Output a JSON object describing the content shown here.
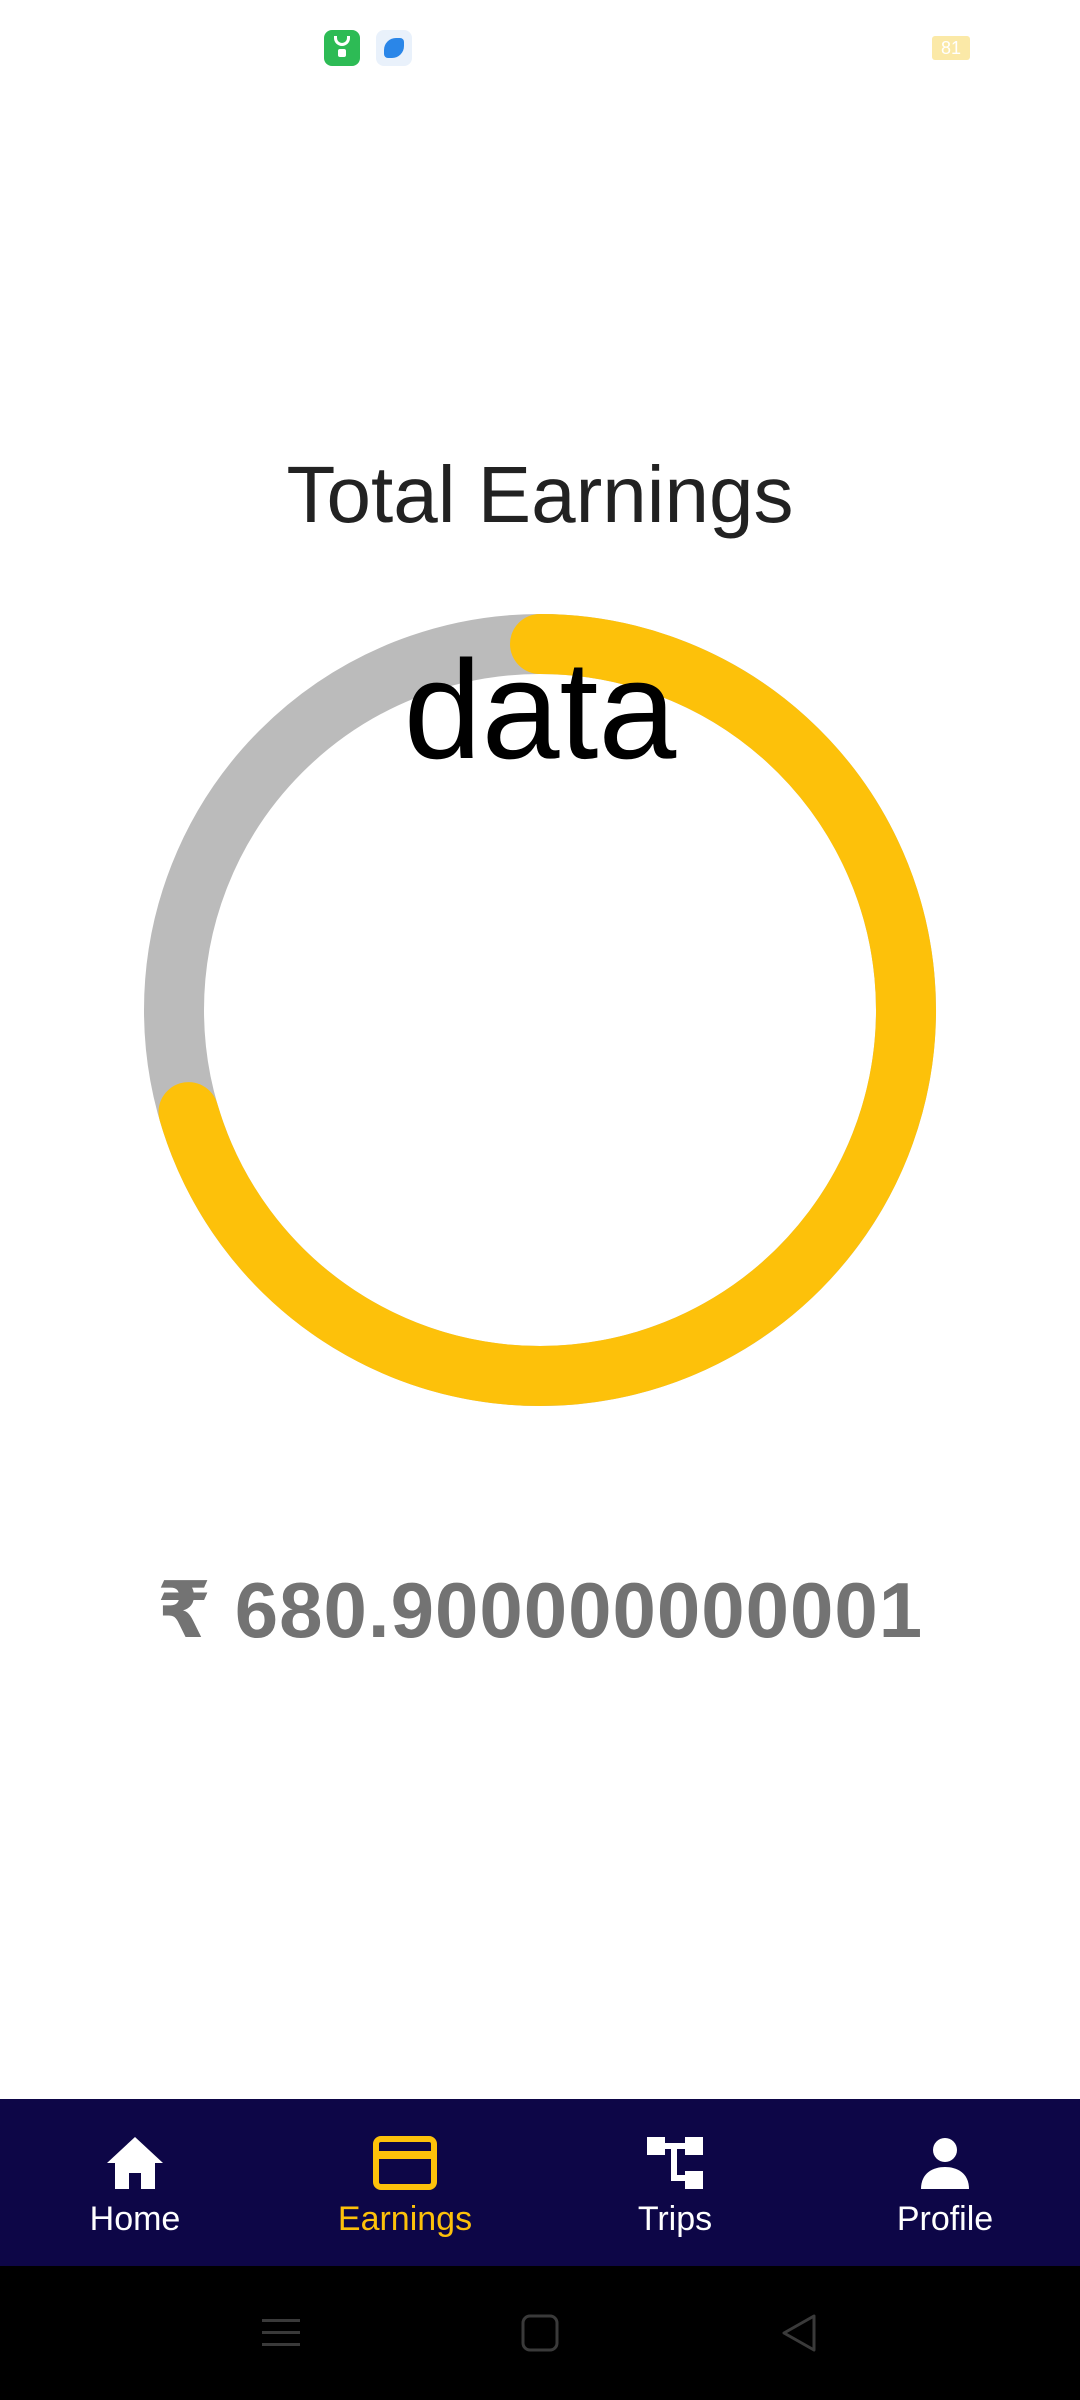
{
  "status_bar": {
    "battery_level": "81",
    "app_icons": [
      "shopping-bag-icon",
      "feather-icon"
    ]
  },
  "page": {
    "title": "Total Earnings",
    "amount": "₹ 680.900000000001"
  },
  "chart_data": {
    "type": "pie",
    "style": "donut",
    "center_label": "data",
    "segments": [
      {
        "color": "#fdc10a",
        "fraction": 0.705
      },
      {
        "color": "#bbbbbb",
        "fraction": 0.295
      }
    ]
  },
  "bottom_nav": {
    "items": [
      {
        "label": "Home",
        "icon": "home-icon",
        "active": false
      },
      {
        "label": "Earnings",
        "icon": "credit-card-icon",
        "active": true
      },
      {
        "label": "Trips",
        "icon": "trips-icon",
        "active": false
      },
      {
        "label": "Profile",
        "icon": "person-icon",
        "active": false
      }
    ]
  },
  "colors": {
    "accent": "#fdc10a",
    "nav_background": "#0d0647",
    "track": "#bbbbbb",
    "amount_text": "#737373"
  },
  "system_nav": {
    "buttons": [
      "menu-icon",
      "home-square-icon",
      "back-triangle-icon"
    ]
  }
}
